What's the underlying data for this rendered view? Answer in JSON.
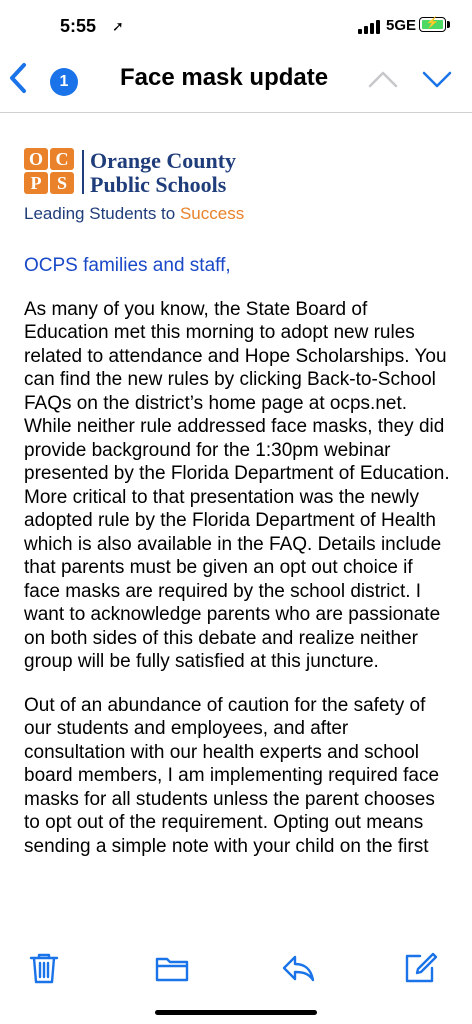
{
  "status": {
    "time": "5:55",
    "location_glyph": "➚",
    "network": "5GE",
    "battery_bolt": "⚡"
  },
  "nav": {
    "back_badge": "1",
    "title": "Face mask update"
  },
  "logo": {
    "boxes": [
      "O",
      "C",
      "P",
      "S"
    ],
    "org_line1": "Orange County",
    "org_line2": "Public Schools",
    "tagline_main": "Leading Students to ",
    "tagline_accent": "Success",
    "brand_color": "#1f3d7a",
    "accent_color": "#e9822a"
  },
  "email": {
    "greeting": "OCPS families and staff,",
    "para1": "As many of you know, the State Board of Education met this morning to adopt new rules related to attendance and Hope Scholarships. You can find the new rules by clicking Back-to-School FAQs on the district’s home page at ocps.net. While neither rule addressed face masks, they did provide background for the 1:30pm webinar presented by the Florida Department of Education.  More critical to that presentation was the newly adopted rule by the Florida Department of Health which is also available in the FAQ. Details include that parents must be given an opt out choice if face masks are required by the school district.  I want to acknowledge parents who are passionate on both sides of this debate and realize neither group will be fully satisfied at this juncture.",
    "para2": "Out of an abundance of caution for the safety of our students and employees, and after consultation with our health experts and school board members, I am implementing required face masks for all students unless the parent chooses to opt out of the requirement.  Opting out means sending a simple note with your child on the first"
  },
  "toolbar": {
    "icons": [
      "trash-icon",
      "folder-icon",
      "reply-icon",
      "compose-icon"
    ],
    "icon_color": "#1a73e8"
  }
}
